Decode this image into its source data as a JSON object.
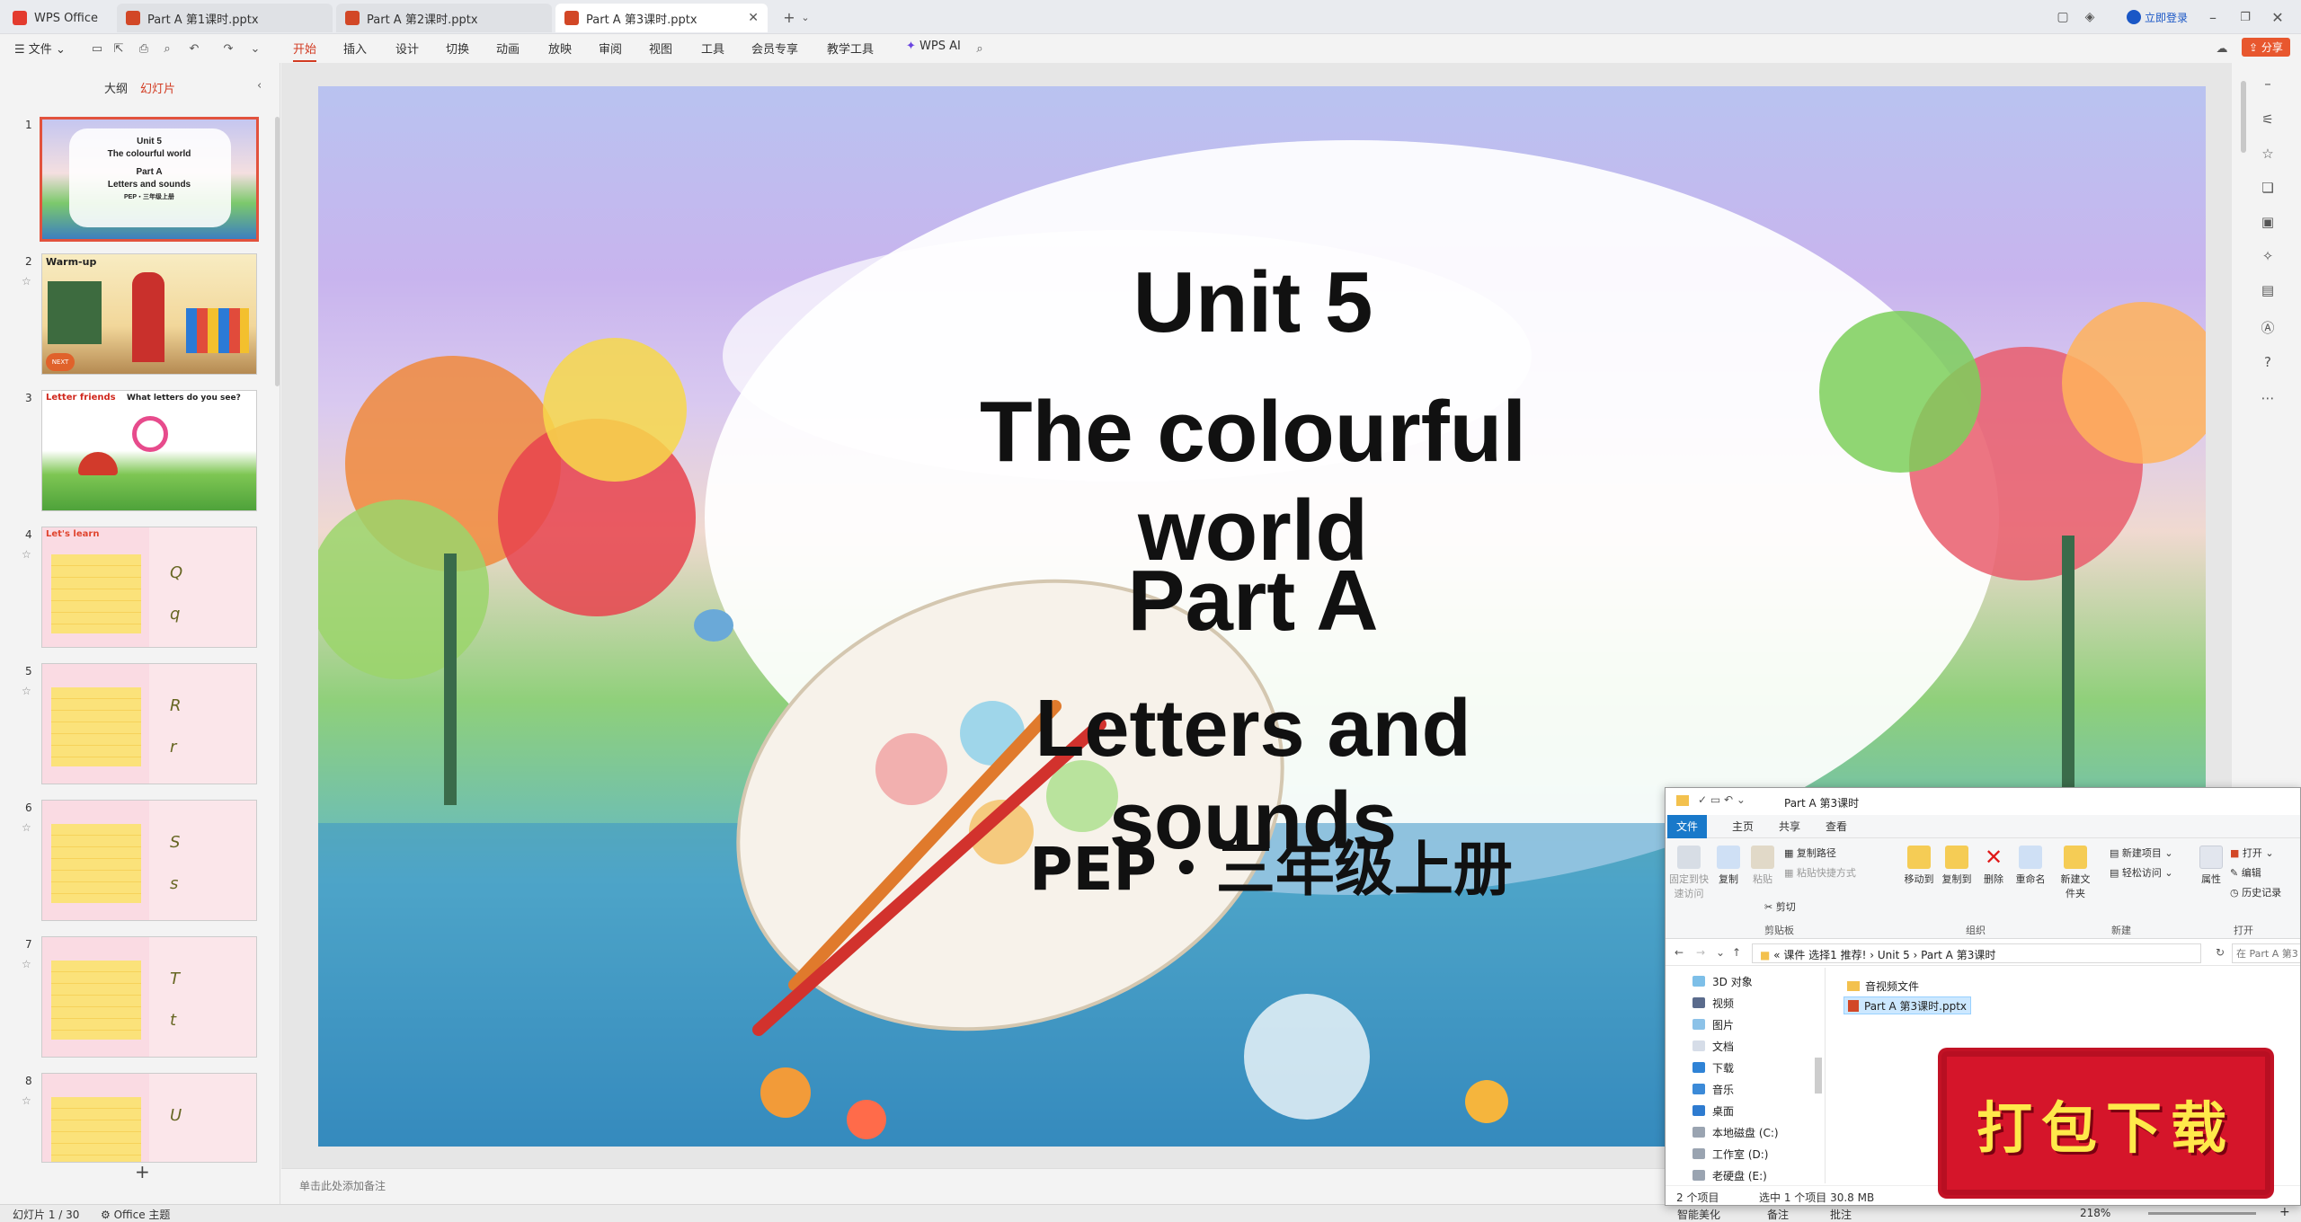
{
  "titlebar": {
    "tabs": [
      {
        "label": "WPS Office",
        "active": false
      },
      {
        "label": "Part A 第1课时.pptx",
        "active": false
      },
      {
        "label": "Part A 第2课时.pptx",
        "active": false
      },
      {
        "label": "Part A 第3课时.pptx",
        "active": true
      }
    ],
    "login_label": "立即登录"
  },
  "menubar": {
    "file_label": "文件",
    "items": [
      "开始",
      "插入",
      "设计",
      "切换",
      "动画",
      "放映",
      "审阅",
      "视图",
      "工具",
      "会员专享",
      "教学工具"
    ],
    "active_item": "开始",
    "ai_label": "WPS AI",
    "share_label": "分享"
  },
  "left_pane": {
    "tabs": [
      "大纲",
      "幻灯片"
    ],
    "active_tab": "幻灯片",
    "slides": [
      {
        "num": "1",
        "lines": [
          "Unit 5",
          "The colourful world",
          "Part A",
          "Letters and sounds",
          "PEP・三年级上册"
        ]
      },
      {
        "num": "2",
        "lines": [
          "Warm-up",
          "NEXT"
        ]
      },
      {
        "num": "3",
        "lines": [
          "Letter friends",
          "What letters do you see?"
        ]
      },
      {
        "num": "4",
        "lines": [
          "Let's learn",
          "Q",
          "q"
        ]
      },
      {
        "num": "5",
        "lines": [
          "R",
          "r"
        ]
      },
      {
        "num": "6",
        "lines": [
          "S",
          "s"
        ]
      },
      {
        "num": "7",
        "lines": [
          "T",
          "t"
        ]
      },
      {
        "num": "8",
        "lines": [
          "U"
        ]
      }
    ],
    "add_label": "+"
  },
  "slide": {
    "title1": "Unit 5",
    "title2": "The colourful world",
    "title3": "Part A",
    "title4": "Letters and sounds",
    "subtitle": "PEP・三年级上册"
  },
  "notes_placeholder": "单击此处添加备注",
  "statusbar": {
    "slide_counter": "幻灯片 1 / 30",
    "theme": "Office 主题",
    "smart_beautify": "智能美化",
    "notes": "备注",
    "comments": "批注",
    "zoom": "218%"
  },
  "explorer": {
    "title": "Part A 第3课时",
    "tabs": [
      "文件",
      "主页",
      "共享",
      "查看"
    ],
    "active_tab": "文件",
    "ribbon": {
      "pin_quick": "固定到快速访问",
      "copy": "复制",
      "paste": "粘贴",
      "copy_path": "复制路径",
      "paste_shortcut": "粘贴快捷方式",
      "cut": "剪切",
      "clipboard_group": "剪贴板",
      "move_to": "移动到",
      "copy_to": "复制到",
      "delete": "删除",
      "rename": "重命名",
      "organize_group": "组织",
      "new_folder": "新建文件夹",
      "new_item": "新建项目",
      "easy_access": "轻松访问",
      "new_group": "新建",
      "properties": "属性",
      "open": "打开",
      "edit": "编辑",
      "history": "历史记录",
      "open_group": "打开"
    },
    "breadcrumb": [
      "课件 选择1 推荐!",
      "Unit 5",
      "Part A 第3课时"
    ],
    "search_placeholder": "在 Part A 第3",
    "nav_items": [
      "3D 对象",
      "视频",
      "图片",
      "文档",
      "下载",
      "音乐",
      "桌面",
      "本地磁盘 (C:)",
      "工作室 (D:)",
      "老硬盘 (E:)"
    ],
    "files": [
      {
        "name": "音视频文件",
        "type": "folder",
        "selected": false
      },
      {
        "name": "Part A 第3课时.pptx",
        "type": "pptx",
        "selected": true
      }
    ],
    "status_count": "2 个项目",
    "status_selected": "选中 1 个项目  30.8 MB"
  },
  "download_banner": "打包下载"
}
